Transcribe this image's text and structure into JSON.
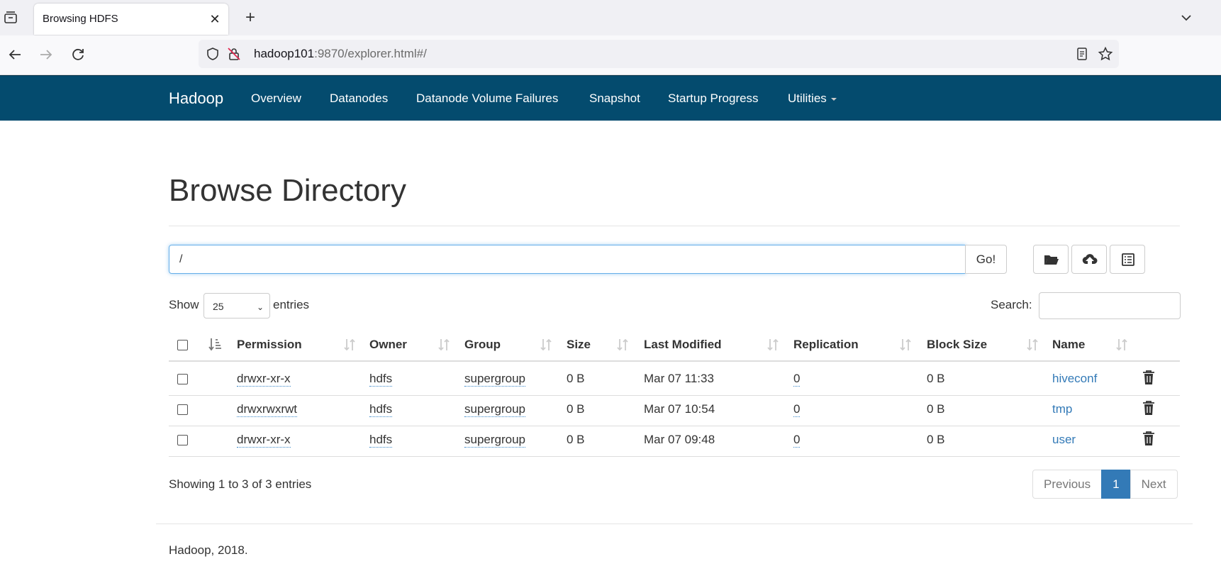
{
  "browser": {
    "tab_title": "Browsing HDFS",
    "url_host": "hadoop101",
    "url_rest": ":9870/explorer.html#/"
  },
  "nav": {
    "brand": "Hadoop",
    "items": [
      "Overview",
      "Datanodes",
      "Datanode Volume Failures",
      "Snapshot",
      "Startup Progress",
      "Utilities"
    ]
  },
  "page": {
    "title": "Browse Directory",
    "path_value": "/",
    "go_label": "Go!",
    "show_label": "Show",
    "entries_value": "25",
    "entries_label": "entries",
    "search_label": "Search:",
    "search_value": ""
  },
  "table": {
    "columns": [
      "Permission",
      "Owner",
      "Group",
      "Size",
      "Last Modified",
      "Replication",
      "Block Size",
      "Name"
    ],
    "rows": [
      {
        "permission": "drwxr-xr-x",
        "owner": "hdfs",
        "group": "supergroup",
        "size": "0 B",
        "modified": "Mar 07 11:33",
        "replication": "0",
        "block_size": "0 B",
        "name": "hiveconf"
      },
      {
        "permission": "drwxrwxrwt",
        "owner": "hdfs",
        "group": "supergroup",
        "size": "0 B",
        "modified": "Mar 07 10:54",
        "replication": "0",
        "block_size": "0 B",
        "name": "tmp"
      },
      {
        "permission": "drwxr-xr-x",
        "owner": "hdfs",
        "group": "supergroup",
        "size": "0 B",
        "modified": "Mar 07 09:48",
        "replication": "0",
        "block_size": "0 B",
        "name": "user"
      }
    ]
  },
  "pagination": {
    "info": "Showing 1 to 3 of 3 entries",
    "previous": "Previous",
    "current": "1",
    "next": "Next"
  },
  "footer": "Hadoop, 2018.",
  "colors": {
    "navbar": "#044b6e",
    "link": "#337ab7",
    "active_page": "#337ab7"
  }
}
